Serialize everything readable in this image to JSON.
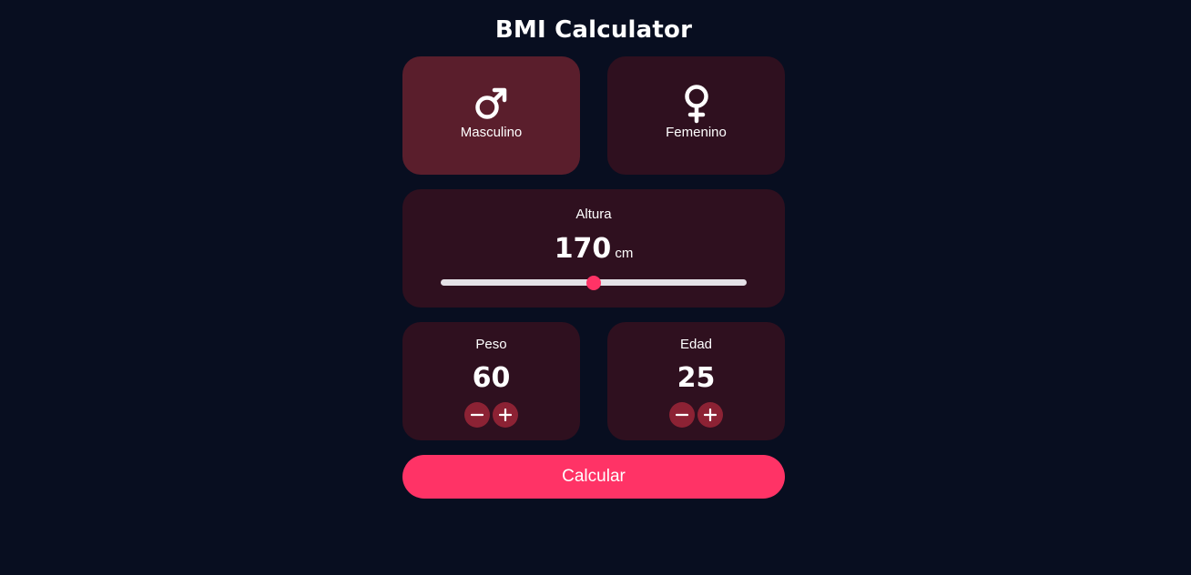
{
  "app": {
    "title": "BMI Calculator"
  },
  "gender": {
    "selected": "male",
    "options": [
      {
        "id": "male",
        "label": "Masculino",
        "icon": "male-symbol-icon"
      },
      {
        "id": "female",
        "label": "Femenino",
        "icon": "female-symbol-icon"
      }
    ]
  },
  "height": {
    "label": "Altura",
    "value": "170",
    "unit": "cm",
    "slider_fraction": 0.5
  },
  "weight": {
    "label": "Peso",
    "value": "60"
  },
  "age": {
    "label": "Edad",
    "value": "25"
  },
  "actions": {
    "calculate_label": "Calcular"
  },
  "colors": {
    "background": "#080e20",
    "card": "#2f101f",
    "card_selected": "#5a1e2c",
    "accent": "#ff3366",
    "stepper_button": "#8c2234",
    "slider_track": "#e4e1e6"
  }
}
